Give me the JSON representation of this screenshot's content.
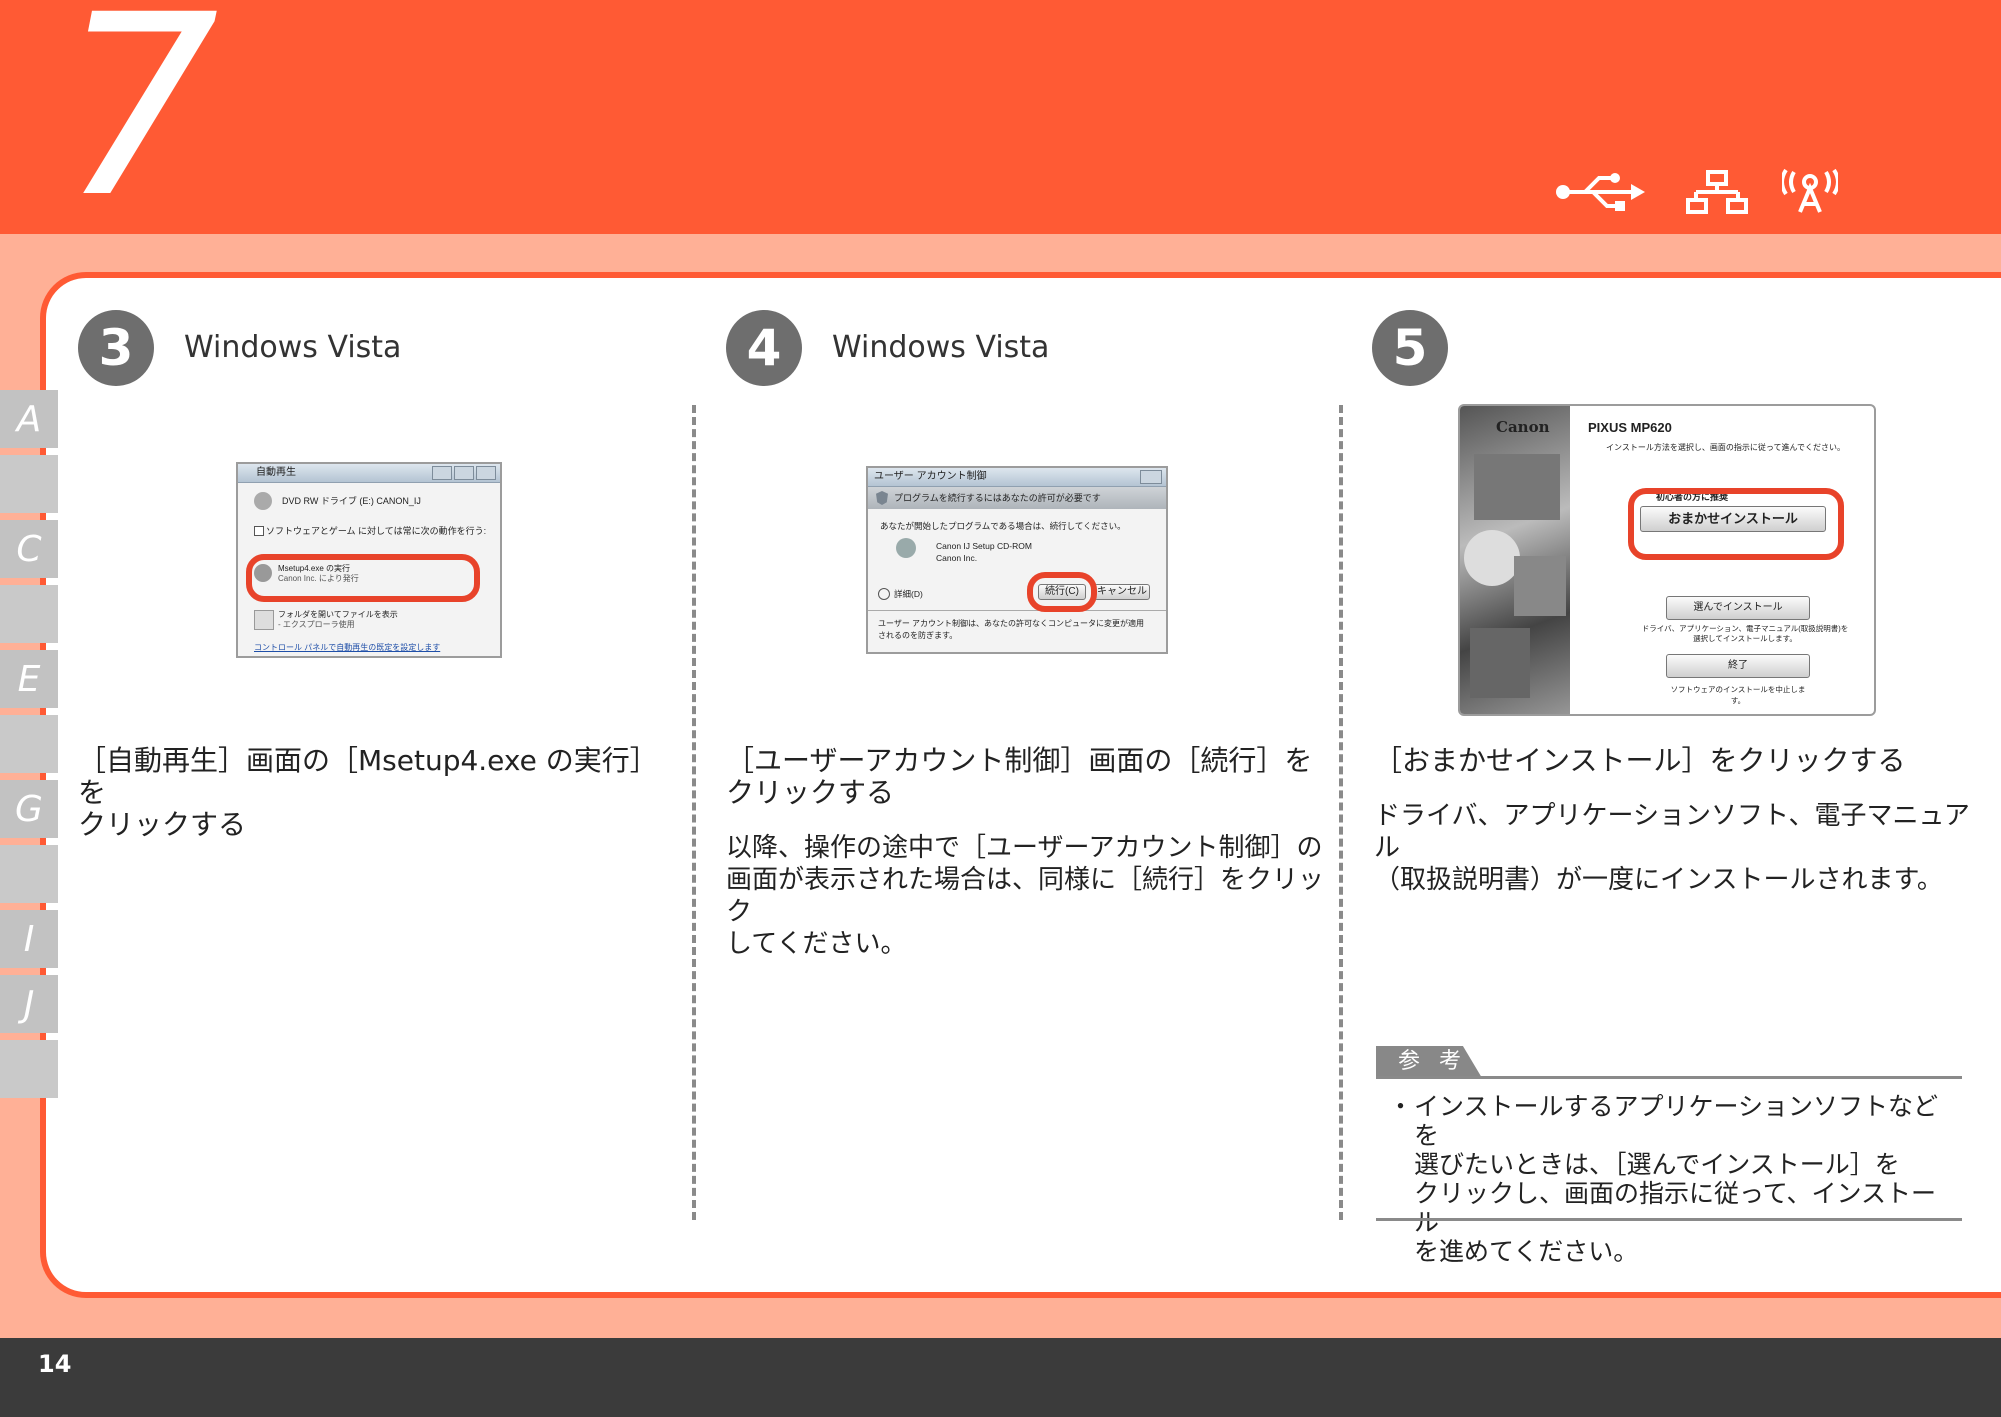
{
  "header": {
    "step": "7",
    "connection_icons": [
      "usb-icon",
      "network-icon",
      "wireless-icon"
    ]
  },
  "side_tabs": [
    "A",
    "",
    "C",
    "",
    "E",
    "",
    "G",
    "",
    "I",
    "J",
    ""
  ],
  "columns": [
    {
      "num": "3",
      "os": "Windows Vista",
      "caption_1": "［自動再生］画面の［Msetup4.exe の実行］を",
      "caption_2": "クリックする",
      "shot": {
        "title": "自動再生",
        "drive": "DVD RW ドライブ (E:) CANON_IJ",
        "checkbox": "ソフトウェアとゲーム に対しては常に次の動作を行う:",
        "item1": "Msetup4.exe の実行",
        "item1_sub": "Canon Inc. により発行",
        "item2": "フォルダを開いてファイルを表示",
        "item2_sub": "- エクスプローラ使用",
        "link": "コントロール パネルで自動再生の既定を設定します"
      }
    },
    {
      "num": "4",
      "os": "Windows Vista",
      "caption_1": "［ユーザーアカウント制御］画面の［続行］を",
      "caption_2": "クリックする",
      "body_1": "以降、操作の途中で［ユーザーアカウント制御］の",
      "body_2": "画面が表示された場合は、同様に［続行］をクリック",
      "body_3": "してください。",
      "shot": {
        "title": "ユーザー アカウント制御",
        "banner": "プログラムを続行するにはあなたの許可が必要です",
        "line": "あなたが開始したプログラムである場合は、続行してください。",
        "app": "Canon IJ Setup CD-ROM",
        "publisher": "Canon Inc.",
        "details": "詳細(D)",
        "continue": "続行(C)",
        "cancel": "キャンセル",
        "footer_1": "ユーザー アカウント制御は、あなたの許可なくコンピュータに変更が適用",
        "footer_2": "されるのを防ぎます。"
      }
    },
    {
      "num": "5",
      "caption": "［おまかせインストール］をクリックする",
      "body_1": "ドライバ、アプリケーションソフト、電子マニュアル",
      "body_2": "（取扱説明書）が一度にインストールされます。",
      "shot": {
        "brand": "Canon",
        "model": "PIXUS MP620",
        "instruction": "インストール方法を選択し、画面の指示に従って進んでください。",
        "recommend": "初心者の方に推奨",
        "easy_install": "おまかせインストール",
        "custom_install": "選んでインストール",
        "custom_note_1": "ドライバ、アプリケーション、電子マニュアル(取扱説明書)を",
        "custom_note_2": "選択してインストールします。",
        "exit": "終了",
        "exit_note": "ソフトウェアのインストールを中止します。"
      }
    }
  ],
  "reference": {
    "label": "参 考",
    "bullet": "・",
    "line_1": "インストールするアプリケーションソフトなどを",
    "line_2": "選びたいときは、［選んでインストール］を",
    "line_3": "クリックし、画面の指示に従って、インストール",
    "line_4": "を進めてください。"
  },
  "page_number": "14"
}
